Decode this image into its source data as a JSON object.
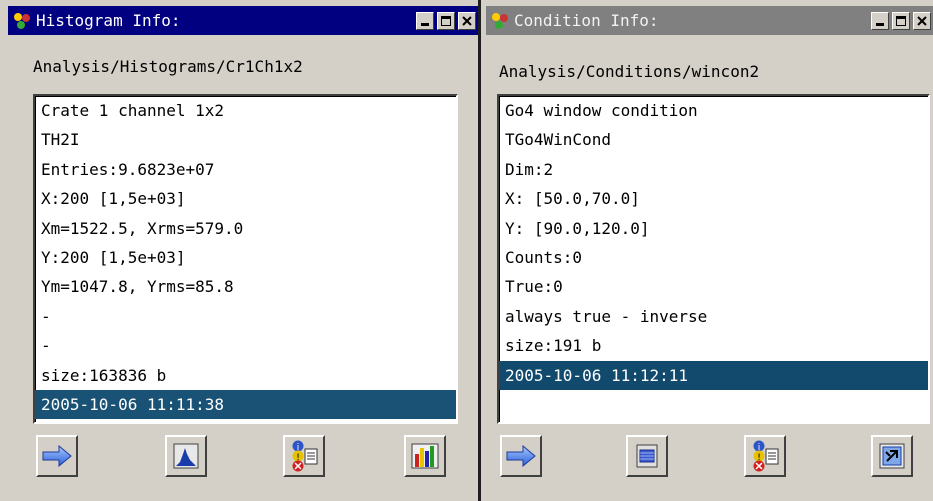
{
  "windows": [
    {
      "title": "Histogram Info:",
      "path": "Analysis/Histograms/Cr1Ch1x2",
      "items": [
        "Crate 1 channel 1x2",
        "TH2I",
        "Entries:9.6823e+07",
        "X:200 [1,5e+03]",
        "Xm=1522.5, Xrms=579.0",
        "Y:200 [1,5e+03]",
        "Ym=1047.8, Yrms=85.8",
        "-",
        "-",
        "size:163836 b",
        "2005-10-06 11:11:38"
      ],
      "selected_index": 10,
      "buttons": [
        "arrow-right-icon",
        "histogram-draw-icon",
        "info-status-icon",
        "bar-chart-icon"
      ],
      "title_bar_color": "#000080"
    },
    {
      "title": "Condition Info:",
      "path": "Analysis/Conditions/wincon2",
      "items": [
        "Go4 window condition",
        "TGo4WinCond",
        "Dim:2",
        "X: [50.0,70.0]",
        "Y: [90.0,120.0]",
        "Counts:0",
        "True:0",
        "always true - inverse",
        "size:191 b",
        "2005-10-06 11:12:11"
      ],
      "selected_index": 9,
      "buttons": [
        "arrow-right-icon",
        "window-condition-icon",
        "info-status-icon",
        "condition-editor-icon"
      ],
      "title_bar_color": "#808080"
    }
  ],
  "colors": {
    "selection": "#1a5276",
    "window_bg": "#d4d0c8",
    "list_bg": "#ffffff"
  }
}
